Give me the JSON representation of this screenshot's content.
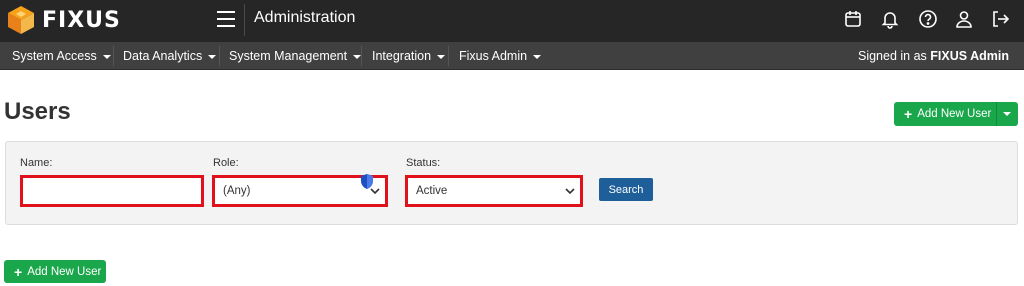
{
  "header": {
    "logo_text": "FIXUS",
    "app_title": "Administration",
    "icons": [
      "calendar-icon",
      "bell-icon",
      "help-icon",
      "user-icon",
      "logout-icon"
    ]
  },
  "nav": {
    "items": [
      {
        "label": "System Access"
      },
      {
        "label": "Data Analytics"
      },
      {
        "label": "System Management"
      },
      {
        "label": "Integration"
      },
      {
        "label": "Fixus Admin"
      }
    ],
    "signed_in_prefix": "Signed in as",
    "signed_in_user": "FIXUS Admin"
  },
  "page": {
    "title": "Users",
    "add_user_label": "Add New User"
  },
  "filters": {
    "name_label": "Name:",
    "name_value": "",
    "role_label": "Role:",
    "role_value": "(Any)",
    "status_label": "Status:",
    "status_value": "Active",
    "search_label": "Search"
  },
  "colors": {
    "accent_green": "#1aa64b",
    "search_blue": "#1f5f99",
    "highlight_red": "#e1111b",
    "topbar": "#262626",
    "navbar": "#404040"
  }
}
